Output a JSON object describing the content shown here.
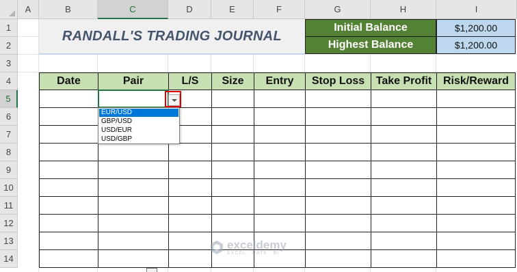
{
  "columns": [
    "A",
    "B",
    "C",
    "D",
    "E",
    "F",
    "G",
    "H",
    "I"
  ],
  "rows": [
    "1",
    "2",
    "3",
    "4",
    "5",
    "6",
    "7",
    "8",
    "9",
    "10",
    "11",
    "12",
    "13",
    "14"
  ],
  "title": "RANDALL'S TRADING JOURNAL",
  "balances": {
    "initial_label": "Initial Balance",
    "initial_value": "$1,200.00",
    "highest_label": "Highest Balance",
    "highest_value": "$1,200.00"
  },
  "table": {
    "headers": [
      "Date",
      "Pair",
      "L/S",
      "Size",
      "Entry",
      "Stop Loss",
      "Take Profit",
      "Risk/Reward"
    ]
  },
  "dropdown": {
    "options": [
      "EUR/USD",
      "GBP/USD",
      "USD/EUR",
      "USD/GBP"
    ],
    "selected": "EUR/USD"
  },
  "watermark": {
    "name": "exceldemy",
    "tagline": "EXCEL · DATA · BI"
  }
}
